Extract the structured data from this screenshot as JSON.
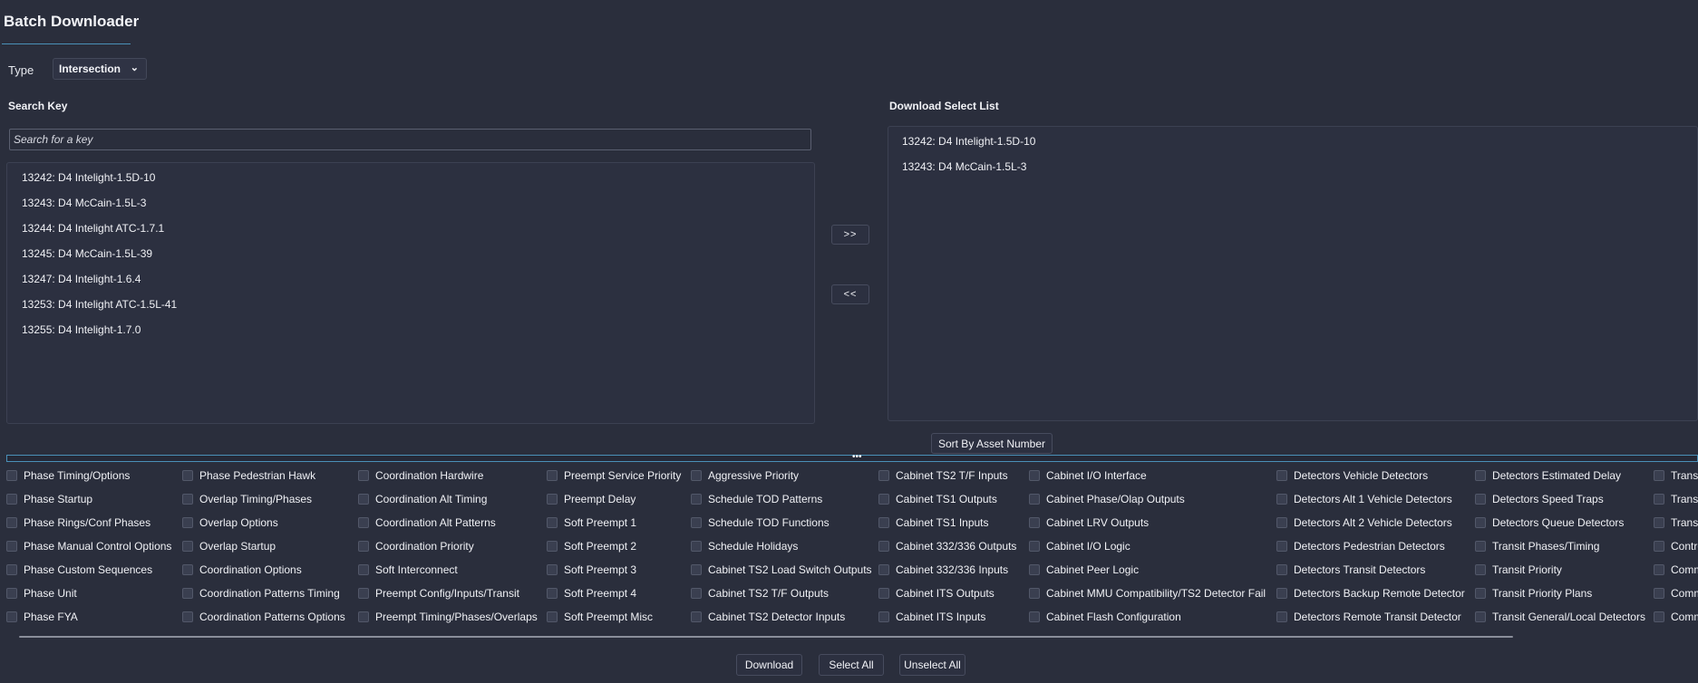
{
  "header": {
    "title": "Batch Downloader"
  },
  "type_field": {
    "label": "Type",
    "value": "Intersection",
    "chevron": "chevron-down-icon"
  },
  "search": {
    "label": "Search Key",
    "placeholder": "Search for a key"
  },
  "search_list": [
    "13242: D4 Intelight-1.5D-10",
    "13243: D4 McCain-1.5L-3",
    "13244: D4 Intelight ATC-1.7.1",
    "13245: D4 McCain-1.5L-39",
    "13247: D4 Intelight-1.6.4",
    "13253: D4 Intelight ATC-1.5L-41",
    "13255: D4 Intelight-1.7.0"
  ],
  "download_list": {
    "label": "Download Select List",
    "items": [
      "13242: D4 Intelight-1.5D-10",
      "13243: D4 McCain-1.5L-3"
    ]
  },
  "buttons": {
    "add": ">>",
    "remove": "<<",
    "sort": "Sort By Asset Number",
    "download": "Download",
    "select_all": "Select All",
    "unselect_all": "Unselect All"
  },
  "splitter": {
    "dots": "•••"
  },
  "options": [
    [
      "Phase Timing/Options",
      "Phase Startup",
      "Phase Rings/Conf Phases",
      "Phase Manual Control Options",
      "Phase Custom Sequences",
      "Phase Unit",
      "Phase FYA"
    ],
    [
      "Phase Pedestrian Hawk",
      "Overlap Timing/Phases",
      "Overlap Options",
      "Overlap Startup",
      "Coordination Options",
      "Coordination Patterns Timing",
      "Coordination Patterns Options"
    ],
    [
      "Coordination Hardwire",
      "Coordination Alt Timing",
      "Coordination Alt Patterns",
      "Coordination Priority",
      "Soft Interconnect",
      "Preempt Config/Inputs/Transit",
      "Preempt Timing/Phases/Overlaps"
    ],
    [
      "Preempt Service Priority",
      "Preempt Delay",
      "Soft Preempt 1",
      "Soft Preempt 2",
      "Soft Preempt 3",
      "Soft Preempt 4",
      "Soft Preempt Misc"
    ],
    [
      "Aggressive Priority",
      "Schedule TOD Patterns",
      "Schedule TOD Functions",
      "Schedule Holidays",
      "Cabinet TS2 Load Switch Outputs",
      "Cabinet TS2 T/F Outputs",
      "Cabinet TS2 Detector Inputs"
    ],
    [
      "Cabinet TS2 T/F Inputs",
      "Cabinet TS1 Outputs",
      "Cabinet TS1 Inputs",
      "Cabinet 332/336 Outputs",
      "Cabinet 332/336 Inputs",
      "Cabinet ITS Outputs",
      "Cabinet ITS Inputs"
    ],
    [
      "Cabinet I/O Interface",
      "Cabinet Phase/Olap Outputs",
      "Cabinet LRV Outputs",
      "Cabinet I/O Logic",
      "Cabinet Peer Logic",
      "Cabinet MMU Compatibility/TS2 Detector Fail",
      "Cabinet Flash Configuration"
    ],
    [
      "Detectors Vehicle Detectors",
      "Detectors Alt 1 Vehicle Detectors",
      "Detectors Alt 2 Vehicle Detectors",
      "Detectors Pedestrian Detectors",
      "Detectors Transit Detectors",
      "Detectors Backup Remote Detector",
      "Detectors Remote Transit Detector"
    ],
    [
      "Detectors Estimated Delay",
      "Detectors Speed Traps",
      "Detectors Queue Detectors",
      "Transit Phases/Timing",
      "Transit Priority",
      "Transit Priority Plans",
      "Transit General/Local Detectors"
    ],
    [
      "Transi",
      "Transi",
      "Transi",
      "Contro",
      "Comm",
      "Comm",
      "Comm"
    ]
  ]
}
